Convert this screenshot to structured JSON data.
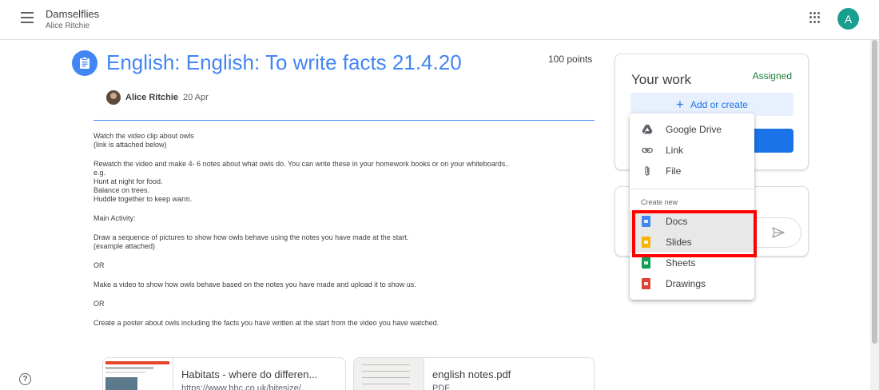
{
  "header": {
    "class_name": "Damselflies",
    "teacher_name": "Alice Ritchie",
    "avatar_letter": "A",
    "avatar_color": "#1a9e8f"
  },
  "assignment": {
    "title": "English: English: To write facts 21.4.20",
    "points": "100 points",
    "author": "Alice Ritchie",
    "date": "20 Apr",
    "description": [
      "Watch the video clip about owls",
      "(link is attached below)",
      "Rewatch the video and make 4- 6 notes about what owls do. You can write these in your homework books or on your whiteboards..",
      "e.g.",
      "Hunt at night for food.",
      "Balance on trees.",
      "Huddle together to keep warm.",
      "Main Activity:",
      "Draw a sequence of pictures to show how owls behave using the notes you have made at the start.",
      "(example attached)",
      "OR",
      "Make a video to show how owls behave based on the notes you have made and upload it to show us.",
      "OR",
      "Create a poster about owls including the facts you have written at the start from the video you have watched."
    ],
    "attachments": [
      {
        "title": "Habitats - where do differen...",
        "subtitle": "https://www.bbc.co.uk/bitesize/..."
      },
      {
        "title": "english notes.pdf",
        "subtitle": "PDF"
      }
    ]
  },
  "your_work": {
    "title": "Your work",
    "status": "Assigned",
    "add_label": "Add or create"
  },
  "menu": {
    "items": [
      {
        "label": "Google Drive",
        "icon": "google-drive-icon"
      },
      {
        "label": "Link",
        "icon": "link-icon"
      },
      {
        "label": "File",
        "icon": "paperclip-icon"
      }
    ],
    "section_label": "Create new",
    "create_items": [
      {
        "label": "Docs",
        "icon": "docs-icon",
        "color": "#4285f4"
      },
      {
        "label": "Slides",
        "icon": "slides-icon",
        "color": "#f4b400"
      },
      {
        "label": "Sheets",
        "icon": "sheets-icon",
        "color": "#0f9d58"
      },
      {
        "label": "Drawings",
        "icon": "drawings-icon",
        "color": "#db4437"
      }
    ]
  },
  "colors": {
    "accent": "#4285f4",
    "primary_button": "#1a73e8",
    "status_green": "#188038",
    "highlight": "#ff0000"
  }
}
